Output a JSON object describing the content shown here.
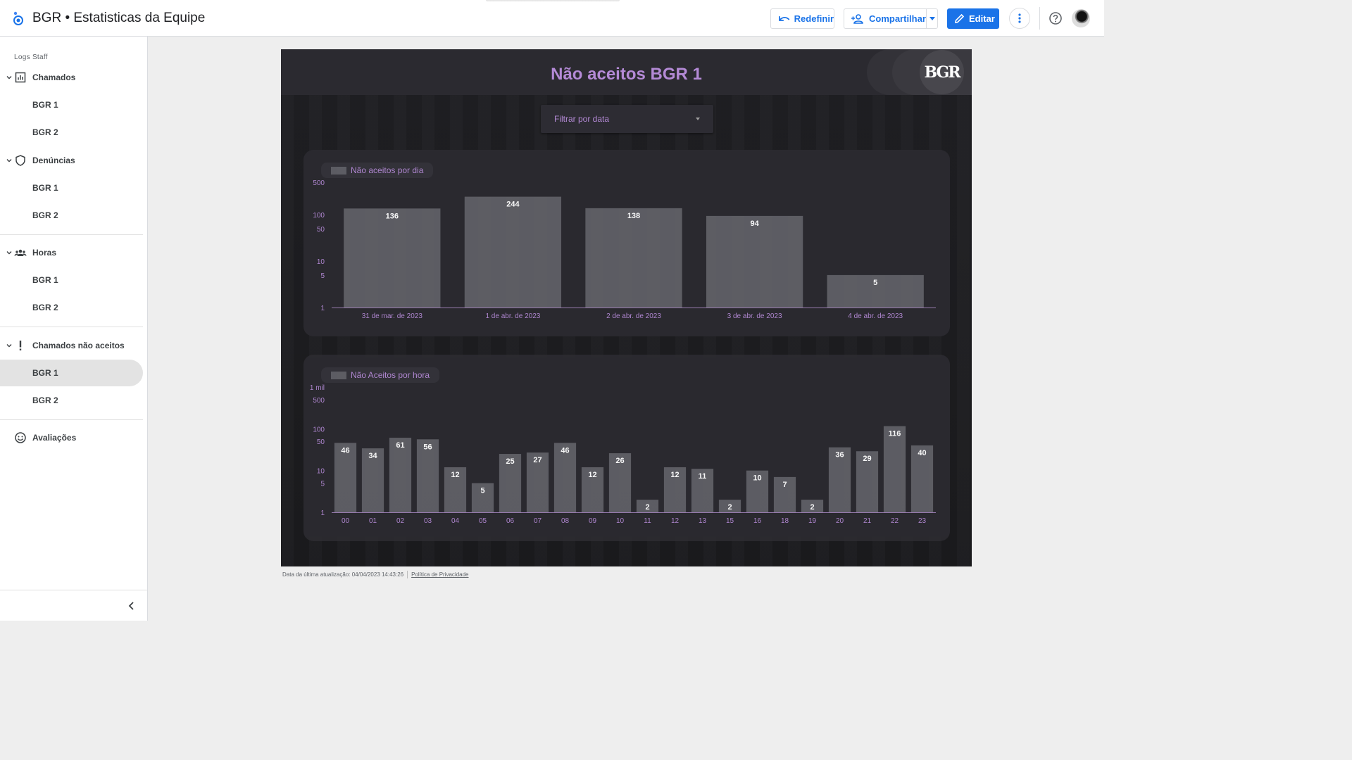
{
  "header": {
    "title": "BGR • Estatisticas da Equipe",
    "reset_label": "Redefinir",
    "share_label": "Compartilhar",
    "edit_label": "Editar"
  },
  "sidebar": {
    "section_title": "Logs Staff",
    "groups": [
      {
        "label": "Chamados",
        "icon": "bar-chart-icon",
        "children": [
          "BGR 1",
          "BGR 2"
        ]
      },
      {
        "label": "Denúncias",
        "icon": "shield-icon",
        "children": [
          "BGR 1",
          "BGR 2"
        ]
      },
      {
        "label": "Horas",
        "icon": "people-icon",
        "children": [
          "BGR 1",
          "BGR 2"
        ]
      },
      {
        "label": "Chamados não aceitos",
        "icon": "exclamation-icon",
        "children": [
          "BGR 1",
          "BGR 2"
        ],
        "active_child": 0
      },
      {
        "label": "Avaliações",
        "icon": "smiley-icon",
        "children": []
      }
    ]
  },
  "report": {
    "title": "Não aceitos BGR 1",
    "logo_text": "BGR",
    "filter_label": "Filtrar por data",
    "accent": "#b48ad6",
    "bar_color": "#5f5f66"
  },
  "chart_data": [
    {
      "type": "bar",
      "title": "",
      "legend": "Não aceitos por dia",
      "y_scale": "log",
      "yticks": [
        "1",
        "5",
        "10",
        "50",
        "100",
        "500"
      ],
      "ylim": [
        1,
        500
      ],
      "categories": [
        "31 de mar. de 2023",
        "1 de abr. de 2023",
        "2 de abr. de 2023",
        "3 de abr. de 2023",
        "4 de abr. de 2023"
      ],
      "values": [
        136,
        244,
        138,
        94,
        5
      ]
    },
    {
      "type": "bar",
      "title": "",
      "legend": "Não Aceitos por hora",
      "y_scale": "log",
      "yticks": [
        "1",
        "5",
        "10",
        "50",
        "100",
        "500",
        "1 mil"
      ],
      "ylim": [
        1,
        1000
      ],
      "categories": [
        "00",
        "01",
        "02",
        "03",
        "04",
        "05",
        "06",
        "07",
        "08",
        "09",
        "10",
        "11",
        "12",
        "13",
        "15",
        "16",
        "18",
        "19",
        "20",
        "21",
        "22",
        "23"
      ],
      "values": [
        46,
        34,
        61,
        56,
        12,
        5,
        25,
        27,
        46,
        12,
        26,
        2,
        12,
        11,
        2,
        10,
        7,
        2,
        36,
        29,
        116,
        40
      ]
    }
  ],
  "footer": {
    "last_update": "Data da última atualização: 04/04/2023 14:43:26",
    "privacy": "Política de Privacidade"
  }
}
